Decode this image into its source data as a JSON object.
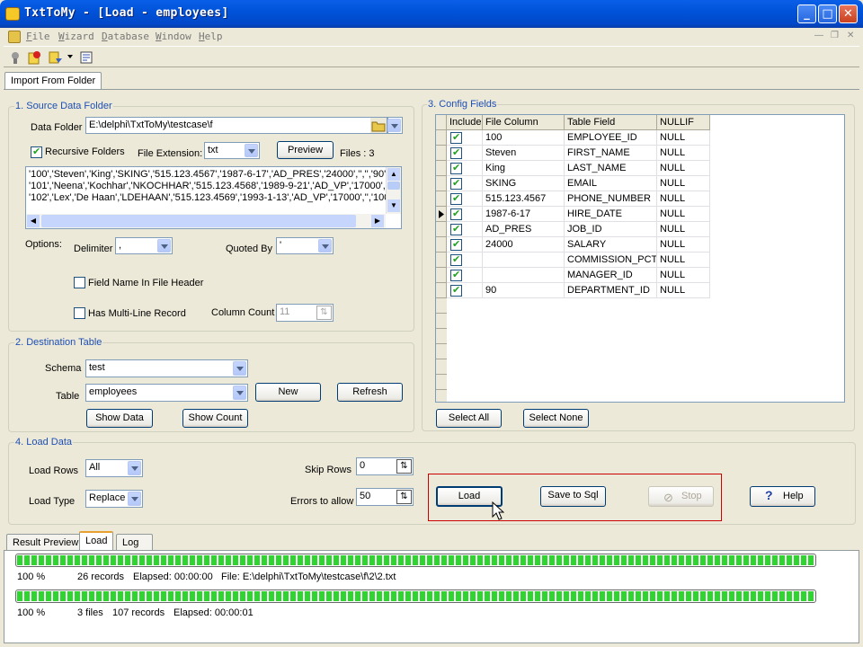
{
  "window": {
    "title": "TxtToMy - [Load - employees]"
  },
  "menu": [
    "File",
    "Wizard",
    "Database",
    "Window",
    "Help"
  ],
  "top_tab": "Import From Folder",
  "source": {
    "title": "1. Source Data Folder",
    "data_folder_label": "Data Folder",
    "data_folder_value": "E:\\delphi\\TxtToMy\\testcase\\f",
    "recursive_label": "Recursive Folders",
    "file_ext_label": "File Extension:",
    "file_ext_value": "txt",
    "preview_label": "Preview",
    "files_label": "Files : 3",
    "preview_lines": [
      "'100','Steven','King','SKING','515.123.4567','1987-6-17','AD_PRES','24000','','','90'",
      "'101','Neena','Kochhar','NKOCHHAR','515.123.4568','1989-9-21','AD_VP','17000','','100','90'",
      "'102','Lex','De Haan','LDEHAAN','515.123.4569','1993-1-13','AD_VP','17000','','100','90'"
    ],
    "options_label": "Options:",
    "delimiter_label": "Delimiter",
    "delimiter_value": ",",
    "quoted_label": "Quoted By",
    "quoted_value": "'",
    "field_name_label": "Field Name In File Header",
    "multiline_label": "Has Multi-Line Record",
    "column_count_label": "Column Count",
    "column_count_value": "11"
  },
  "dest": {
    "title": "2. Destination Table",
    "schema_label": "Schema",
    "schema_value": "test",
    "table_label": "Table",
    "table_value": "employees",
    "new_label": "New",
    "refresh_label": "Refresh",
    "show_data_label": "Show Data",
    "show_count_label": "Show Count"
  },
  "config": {
    "title": "3. Config Fields",
    "headers": [
      "Include",
      "File Column",
      "Table Field",
      "NULLIF"
    ],
    "rows": [
      {
        "file": "100",
        "field": "EMPLOYEE_ID",
        "nullif": "NULL"
      },
      {
        "file": "Steven",
        "field": "FIRST_NAME",
        "nullif": "NULL"
      },
      {
        "file": "King",
        "field": "LAST_NAME",
        "nullif": "NULL"
      },
      {
        "file": "SKING",
        "field": "EMAIL",
        "nullif": "NULL"
      },
      {
        "file": "515.123.4567",
        "field": "PHONE_NUMBER",
        "nullif": "NULL"
      },
      {
        "file": "1987-6-17",
        "field": "HIRE_DATE",
        "nullif": "NULL"
      },
      {
        "file": "AD_PRES",
        "field": "JOB_ID",
        "nullif": "NULL"
      },
      {
        "file": "24000",
        "field": "SALARY",
        "nullif": "NULL"
      },
      {
        "file": "",
        "field": "COMMISSION_PCT",
        "nullif": "NULL"
      },
      {
        "file": "",
        "field": "MANAGER_ID",
        "nullif": "NULL"
      },
      {
        "file": "90",
        "field": "DEPARTMENT_ID",
        "nullif": "NULL"
      }
    ],
    "select_all_label": "Select All",
    "select_none_label": "Select None"
  },
  "load": {
    "title": "4. Load Data",
    "load_rows_label": "Load Rows",
    "load_rows_value": "All",
    "load_type_label": "Load Type",
    "load_type_value": "Replace",
    "skip_rows_label": "Skip Rows",
    "skip_rows_value": "0",
    "errors_label": "Errors to allow",
    "errors_value": "50",
    "load_btn": "Load",
    "save_sql_btn": "Save to Sql",
    "stop_btn": "Stop",
    "help_btn": "Help",
    "highlight_color": "#CC0000"
  },
  "bottom_tabs": [
    "Result Preview",
    "Load",
    "Log"
  ],
  "progress": [
    {
      "fraction": 1.0,
      "pct": "100 %",
      "c1": "26 records",
      "c2": "Elapsed: 00:00:00",
      "c3": "File: E:\\delphi\\TxtToMy\\testcase\\f\\2\\2.txt"
    },
    {
      "fraction": 1.0,
      "pct": "100 %",
      "c1": "3 files",
      "c2": "107 records",
      "c3": "Elapsed: 00:00:01"
    }
  ]
}
